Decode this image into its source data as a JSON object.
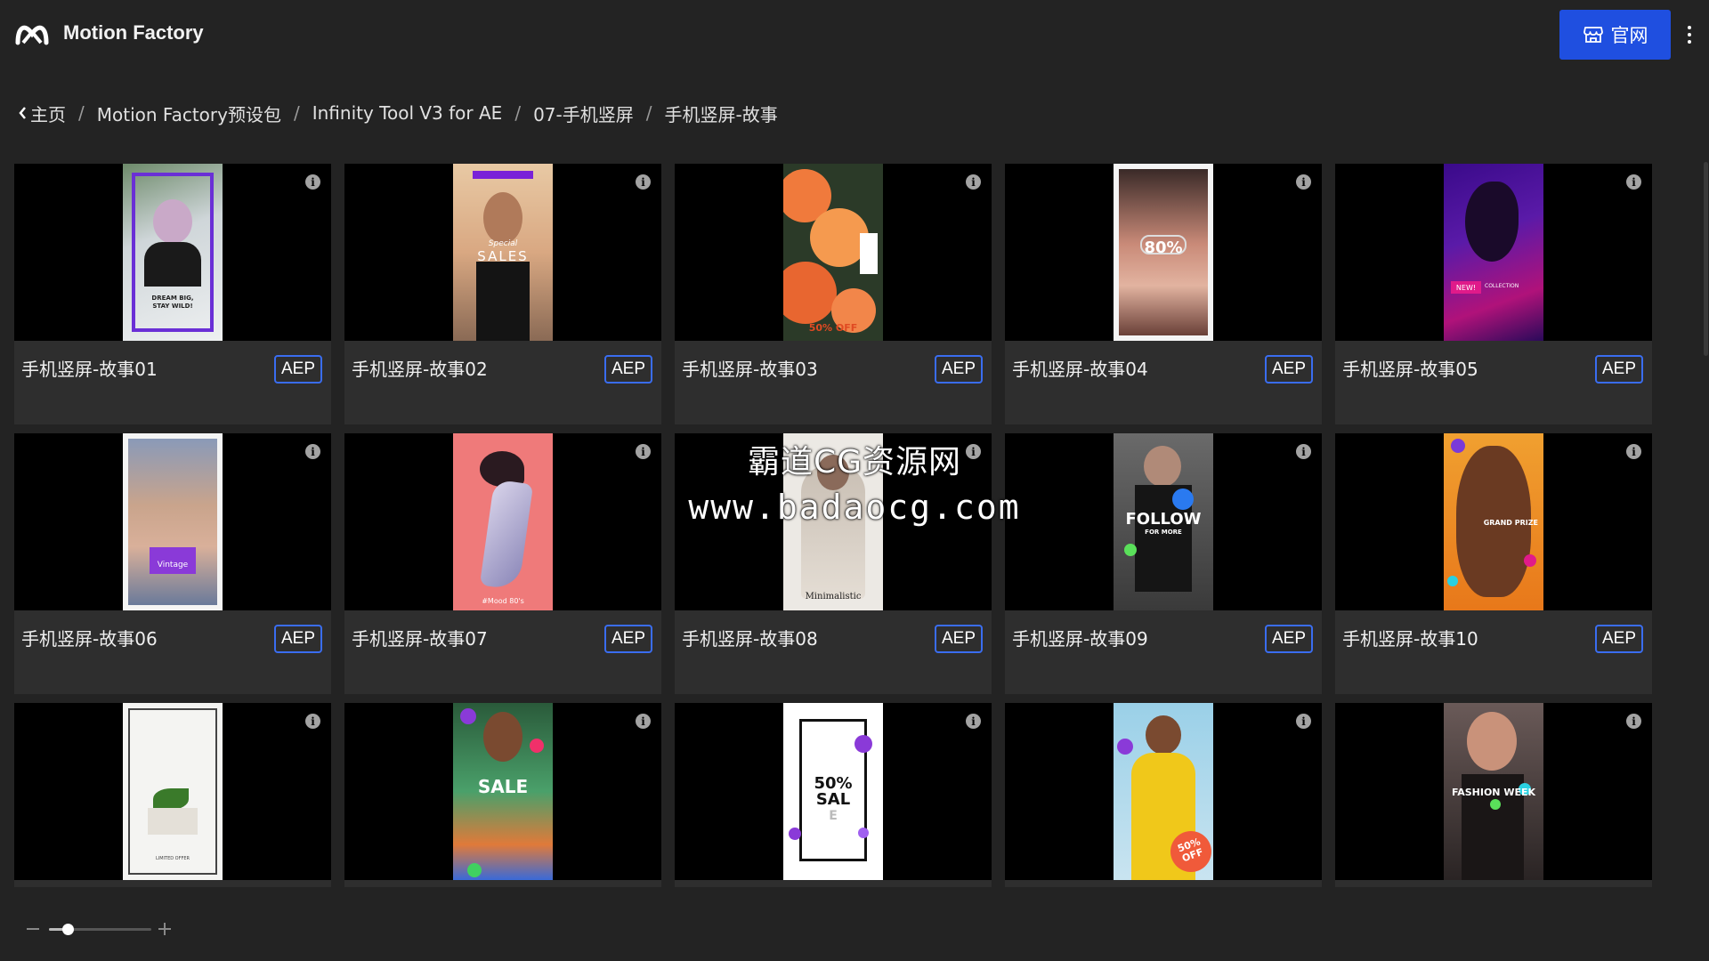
{
  "header": {
    "app_title": "Motion Factory",
    "official_label": "官网",
    "accent": "#1f4fe0"
  },
  "breadcrumb": [
    "主页",
    "Motion Factory预设包",
    "Infinity Tool V3 for AE",
    "07-手机竖屏",
    "手机竖屏-故事"
  ],
  "items": [
    {
      "title": "手机竖屏-故事01",
      "badge": "AEP",
      "texts": [
        "DREAM BIG,",
        "STAY WILD!"
      ],
      "icon": "story-thumbnail-purple-frame"
    },
    {
      "title": "手机竖屏-故事02",
      "badge": "AEP",
      "texts": [
        "Special",
        "SALES"
      ],
      "icon": "story-thumbnail-sunset"
    },
    {
      "title": "手机竖屏-故事03",
      "badge": "AEP",
      "texts": [
        "50% OFF"
      ],
      "icon": "story-thumbnail-roses"
    },
    {
      "title": "手机竖屏-故事04",
      "badge": "AEP",
      "texts": [
        "80%"
      ],
      "icon": "story-thumbnail-portrait"
    },
    {
      "title": "手机竖屏-故事05",
      "badge": "AEP",
      "texts": [
        "NEW!",
        "COLLECTION"
      ],
      "icon": "story-thumbnail-neon"
    },
    {
      "title": "手机竖屏-故事06",
      "badge": "AEP",
      "texts": [
        "Vintage"
      ],
      "icon": "story-thumbnail-vintage"
    },
    {
      "title": "手机竖屏-故事07",
      "badge": "AEP",
      "texts": [
        "#Mood 80's"
      ],
      "icon": "story-thumbnail-pink"
    },
    {
      "title": "手机竖屏-故事08",
      "badge": "AEP",
      "texts": [
        "Minimalistic"
      ],
      "icon": "story-thumbnail-minimal"
    },
    {
      "title": "手机竖屏-故事09",
      "badge": "AEP",
      "texts": [
        "FOLLOW",
        "FOR MORE"
      ],
      "icon": "story-thumbnail-follow"
    },
    {
      "title": "手机竖屏-故事10",
      "badge": "AEP",
      "texts": [
        "GRAND PRIZE"
      ],
      "icon": "story-thumbnail-prize"
    },
    {
      "title": "",
      "badge": "",
      "texts": [
        "LIMITED OFFER"
      ],
      "icon": "story-thumbnail-plant"
    },
    {
      "title": "",
      "badge": "",
      "texts": [
        "SALE"
      ],
      "icon": "story-thumbnail-tropical"
    },
    {
      "title": "",
      "badge": "",
      "texts": [
        "50%",
        "SAL",
        "E"
      ],
      "icon": "story-thumbnail-50-sale"
    },
    {
      "title": "",
      "badge": "",
      "texts": [
        "50%",
        "OFF"
      ],
      "icon": "story-thumbnail-yellow"
    },
    {
      "title": "",
      "badge": "",
      "texts": [
        "FASHION WEEK"
      ],
      "icon": "story-thumbnail-fashion"
    }
  ],
  "watermark": {
    "line1": "霸道CG资源网",
    "line2": "www.badaocg.com"
  },
  "zoom": {
    "level": 0.18
  }
}
